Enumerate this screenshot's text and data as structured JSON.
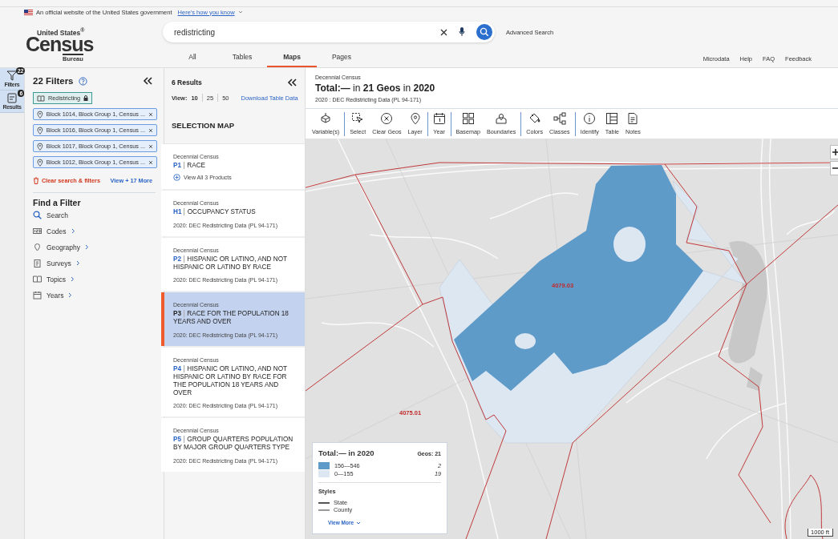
{
  "banner": {
    "text": "An official website of the United States government",
    "link": "Here's how you know"
  },
  "logo": {
    "top": "United States$^{®}$",
    "main": "Census",
    "bottom": "Bureau"
  },
  "search": {
    "value": "redistricting"
  },
  "advanced_search": "Advanced Search",
  "nav_tabs": [
    {
      "label": "All",
      "selected": false
    },
    {
      "label": "Tables",
      "selected": false
    },
    {
      "label": "Maps",
      "selected": true
    },
    {
      "label": "Pages",
      "selected": false
    }
  ],
  "utility_links": [
    "Microdata",
    "Help",
    "FAQ",
    "Feedback"
  ],
  "rail": [
    {
      "kind": "filters",
      "label": "Filters",
      "count": "22"
    },
    {
      "kind": "results",
      "label": "Results",
      "count": "6"
    }
  ],
  "filters": {
    "title": "22 Filters",
    "chips": [
      {
        "kind": "topic",
        "label": "Redistricting"
      },
      {
        "kind": "geo",
        "label": "Block 1014, Block Group 1, Census ..."
      },
      {
        "kind": "geo",
        "label": "Block 1016, Block Group 1, Census ..."
      },
      {
        "kind": "geo",
        "label": "Block 1017, Block Group 1, Census ..."
      },
      {
        "kind": "geo",
        "label": "Block 1012, Block Group 1, Census ..."
      }
    ],
    "clear": "Clear search & filters",
    "view_more": "View + 17 More"
  },
  "find_filter": {
    "title": "Find a Filter",
    "items": [
      {
        "kind": "search",
        "label": "Search"
      },
      {
        "kind": "codes",
        "label": "Codes"
      },
      {
        "kind": "geography",
        "label": "Geography"
      },
      {
        "kind": "surveys",
        "label": "Surveys"
      },
      {
        "kind": "topics",
        "label": "Topics"
      },
      {
        "kind": "years",
        "label": "Years"
      }
    ]
  },
  "results": {
    "count": "6 Results",
    "view_label": "View:",
    "view_options": [
      {
        "label": "10",
        "selected": true
      },
      {
        "label": "25",
        "selected": false
      },
      {
        "label": "50",
        "selected": false
      }
    ],
    "download": "Download Table Data",
    "selection_map": "SELECTION MAP",
    "items": [
      {
        "source": "Decennial Census",
        "code": "P1",
        "title": "RACE",
        "link": "View All 3 Products",
        "selected": false
      },
      {
        "source": "Decennial Census",
        "code": "H1",
        "title": "OCCUPANCY STATUS",
        "meta": "2020: DEC Redistricting Data (PL 94-171)",
        "selected": false
      },
      {
        "source": "Decennial Census",
        "code": "P2",
        "title": "HISPANIC OR LATINO, AND NOT HISPANIC OR LATINO BY RACE",
        "meta": "2020: DEC Redistricting Data (PL 94-171)",
        "selected": false
      },
      {
        "source": "Decennial Census",
        "code": "P3",
        "title": "RACE FOR THE POPULATION 18 YEARS AND OVER",
        "meta": "2020: DEC Redistricting Data (PL 94-171)",
        "selected": true
      },
      {
        "source": "Decennial Census",
        "code": "P4",
        "title": "HISPANIC OR LATINO, AND NOT HISPANIC OR LATINO BY RACE FOR THE POPULATION 18 YEARS AND OVER",
        "meta": "2020: DEC Redistricting Data (PL 94-171)",
        "selected": false
      },
      {
        "source": "Decennial Census",
        "code": "P5",
        "title": "GROUP QUARTERS POPULATION BY MAJOR GROUP QUARTERS TYPE",
        "meta": "2020: DEC Redistricting Data (PL 94-171)",
        "selected": false
      }
    ]
  },
  "map": {
    "source": "Decennial Census",
    "title": "**Total:—** in **21 Geos** in **2020**",
    "subtitle": "2020 : DEC Redistricting Data (PL 94-171)",
    "tools": [
      {
        "kind": "variables",
        "label": "Variable(s)",
        "divider_after": true
      },
      {
        "kind": "select",
        "label": "Select",
        "divider_after": false
      },
      {
        "kind": "clear",
        "label": "Clear Geos",
        "divider_after": false
      },
      {
        "kind": "layer",
        "label": "Layer",
        "divider_after": true
      },
      {
        "kind": "year",
        "label": "Year",
        "divider_after": true
      },
      {
        "kind": "basemap",
        "label": "Basemap",
        "divider_after": false
      },
      {
        "kind": "boundaries",
        "label": "Boundaries",
        "divider_after": true
      },
      {
        "kind": "colors",
        "label": "Colors",
        "divider_after": false
      },
      {
        "kind": "classes",
        "label": "Classes",
        "divider_after": true
      },
      {
        "kind": "identify",
        "label": "Identify",
        "divider_after": false
      },
      {
        "kind": "table",
        "label": "Table",
        "divider_after": false
      },
      {
        "kind": "notes",
        "label": "Notes",
        "divider_after": false
      }
    ],
    "tract_labels": [
      "4079.03",
      "4075.01"
    ],
    "scale": "1000 ft",
    "legend": {
      "title": "Total:— in 2020",
      "geos": "Geos: 21",
      "classes": [
        {
          "range": "156—546",
          "count": "2",
          "color": "#5f9bc8"
        },
        {
          "range": "0—155",
          "count": "19",
          "color": "#dde7f2"
        }
      ],
      "styles_title": "Styles",
      "styles": [
        {
          "kind": "state",
          "label": "State"
        },
        {
          "kind": "county",
          "label": "County"
        }
      ],
      "view_more": "View More"
    }
  }
}
